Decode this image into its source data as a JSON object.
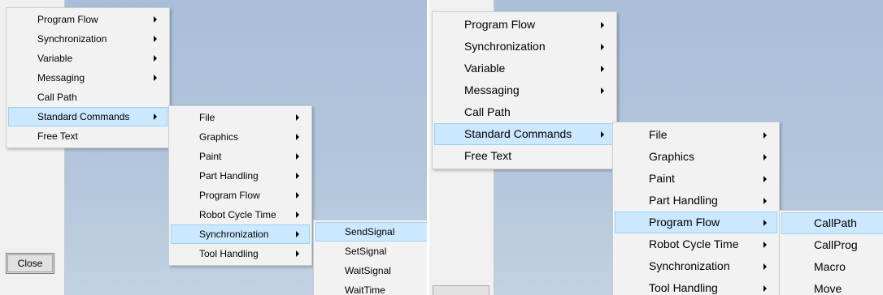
{
  "left": {
    "close_label": "Close",
    "main_menu": [
      {
        "label": "Program Flow",
        "sub": true
      },
      {
        "label": "Synchronization",
        "sub": true
      },
      {
        "label": "Variable",
        "sub": true
      },
      {
        "label": "Messaging",
        "sub": true
      },
      {
        "label": "Call Path",
        "sub": false
      },
      {
        "label": "Standard Commands",
        "sub": true,
        "highlighted": true
      },
      {
        "label": "Free Text",
        "sub": false
      }
    ],
    "standard_commands_menu": [
      {
        "label": "File",
        "sub": true
      },
      {
        "label": "Graphics",
        "sub": true
      },
      {
        "label": "Paint",
        "sub": true
      },
      {
        "label": "Part Handling",
        "sub": true
      },
      {
        "label": "Program Flow",
        "sub": true
      },
      {
        "label": "Robot Cycle Time",
        "sub": true
      },
      {
        "label": "Synchronization",
        "sub": true,
        "highlighted": true
      },
      {
        "label": "Tool Handling",
        "sub": true
      }
    ],
    "synchronization_menu": [
      {
        "label": "SendSignal",
        "highlighted": true
      },
      {
        "label": "SetSignal"
      },
      {
        "label": "WaitSignal"
      },
      {
        "label": "WaitTime"
      }
    ]
  },
  "right": {
    "main_menu": [
      {
        "label": "Program Flow",
        "sub": true
      },
      {
        "label": "Synchronization",
        "sub": true
      },
      {
        "label": "Variable",
        "sub": true
      },
      {
        "label": "Messaging",
        "sub": true
      },
      {
        "label": "Call Path",
        "sub": false
      },
      {
        "label": "Standard Commands",
        "sub": true,
        "highlighted": true
      },
      {
        "label": "Free Text",
        "sub": false
      }
    ],
    "standard_commands_menu": [
      {
        "label": "File",
        "sub": true
      },
      {
        "label": "Graphics",
        "sub": true
      },
      {
        "label": "Paint",
        "sub": true
      },
      {
        "label": "Part Handling",
        "sub": true
      },
      {
        "label": "Program Flow",
        "sub": true,
        "highlighted": true
      },
      {
        "label": "Robot Cycle Time",
        "sub": true
      },
      {
        "label": "Synchronization",
        "sub": true
      },
      {
        "label": "Tool Handling",
        "sub": true
      }
    ],
    "program_flow_menu": [
      {
        "label": "CallPath",
        "highlighted": true
      },
      {
        "label": "CallProg"
      },
      {
        "label": "Macro"
      },
      {
        "label": "Move"
      }
    ]
  }
}
